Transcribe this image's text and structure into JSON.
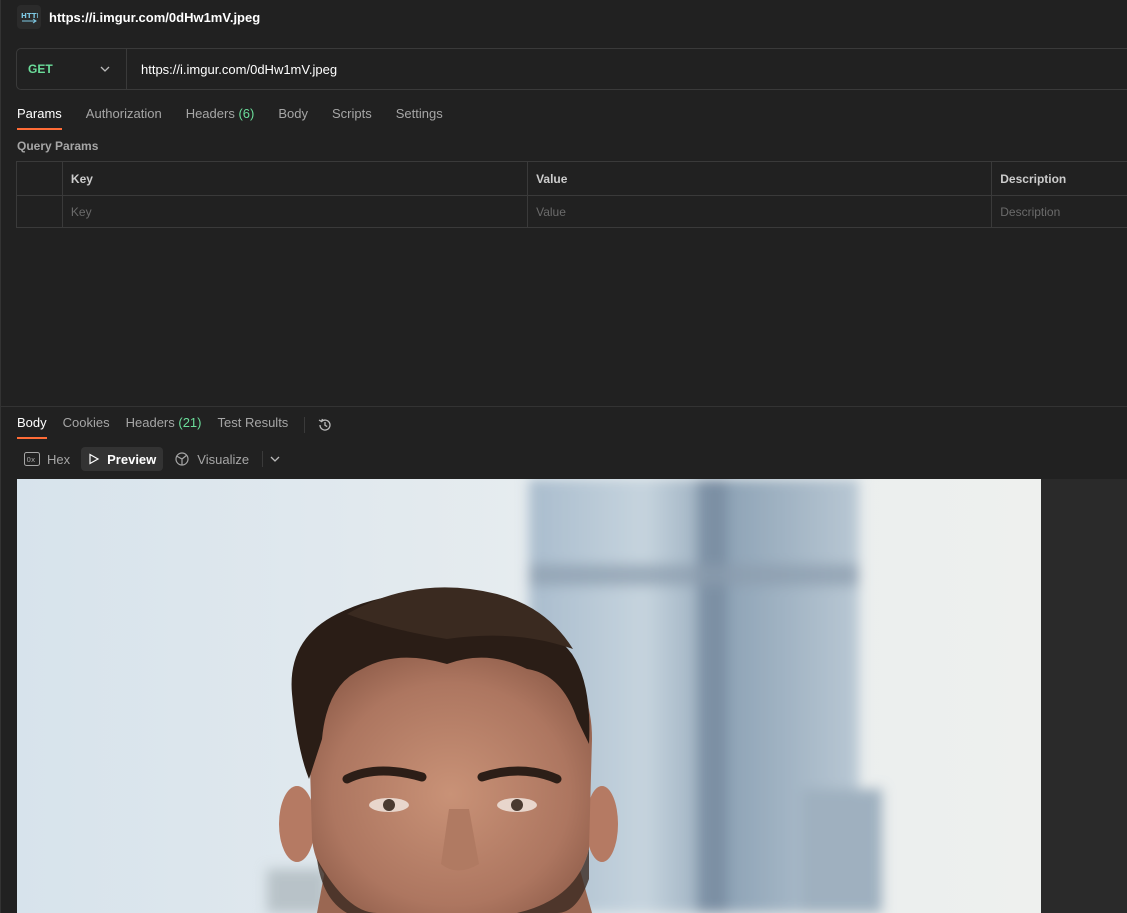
{
  "request": {
    "title": "https://i.imgur.com/0dHw1mV.jpeg",
    "method": "GET",
    "url": "https://i.imgur.com/0dHw1mV.jpeg"
  },
  "request_tabs": [
    {
      "label": "Params",
      "active": true
    },
    {
      "label": "Authorization"
    },
    {
      "label": "Headers",
      "count": "(6)"
    },
    {
      "label": "Body"
    },
    {
      "label": "Scripts"
    },
    {
      "label": "Settings"
    }
  ],
  "query_params": {
    "label": "Query Params",
    "columns": [
      "Key",
      "Value",
      "Description"
    ],
    "placeholders": [
      "Key",
      "Value",
      "Description"
    ]
  },
  "response_tabs": [
    {
      "label": "Body",
      "active": true
    },
    {
      "label": "Cookies"
    },
    {
      "label": "Headers",
      "count": "(21)"
    },
    {
      "label": "Test Results"
    }
  ],
  "view_modes": {
    "hex": "Hex",
    "preview": "Preview",
    "visualize": "Visualize",
    "selected": "Preview"
  },
  "colors": {
    "background": "#212121",
    "method_get": "#6bdd9a",
    "count": "#6bdd9a",
    "active_tab_underline": "#ff6c37"
  },
  "icons": [
    "http-icon",
    "chevron-down-icon",
    "history-icon",
    "hex-icon",
    "play-icon",
    "visualize-icon"
  ],
  "preview_image": {
    "subject": "photo of a smiling man in front of a tall glass skyscraper"
  }
}
